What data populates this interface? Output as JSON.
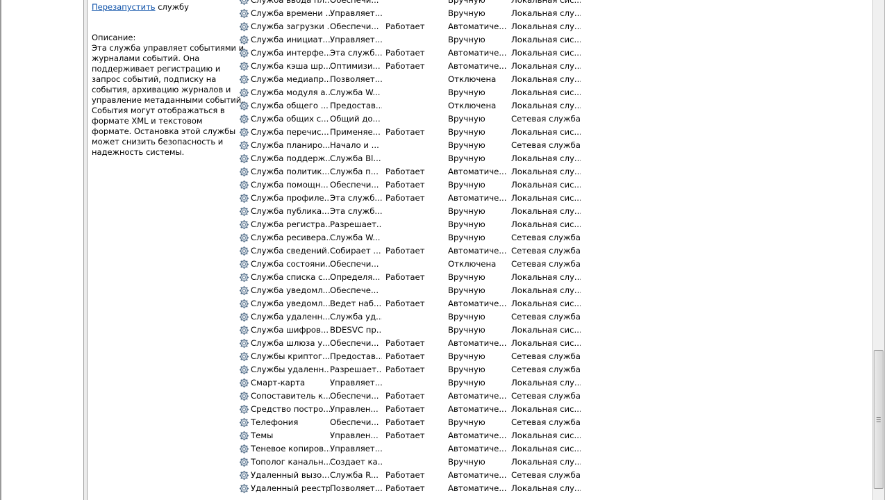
{
  "description_pane": {
    "restart_link": "Перезапустить",
    "restart_suffix": " службу",
    "description_label": "Описание:",
    "description_lines": [
      "Эта служба управляет событиями и",
      "журналами событий. Она",
      "поддерживает регистрацию и",
      "запрос событий, подписку на",
      "события, архивацию журналов и",
      "управление метаданными событий.",
      "События могут отображаться в",
      "формате XML и текстовом",
      "формате. Остановка этой службы",
      "может снизить безопасность и",
      "надежность системы."
    ]
  },
  "services": [
    {
      "name": "Служба ввода пл...",
      "description": "Обеспечи...",
      "status": "",
      "startup": "Вручную",
      "logon": "Локальная сис..."
    },
    {
      "name": "Служба времени ...",
      "description": "Управляет...",
      "status": "",
      "startup": "Вручную",
      "logon": "Локальная слу..."
    },
    {
      "name": "Служба загрузки ...",
      "description": "Обеспечи...",
      "status": "Работает",
      "startup": "Автоматиче...",
      "logon": "Локальная слу..."
    },
    {
      "name": "Служба инициат...",
      "description": "Управляет...",
      "status": "",
      "startup": "Вручную",
      "logon": "Локальная сис..."
    },
    {
      "name": "Служба интерфе...",
      "description": "Эта служб...",
      "status": "Работает",
      "startup": "Автоматиче...",
      "logon": "Локальная сис..."
    },
    {
      "name": "Служба кэша шр...",
      "description": "Оптимизи...",
      "status": "Работает",
      "startup": "Автоматиче...",
      "logon": "Локальная слу..."
    },
    {
      "name": "Служба медиапр...",
      "description": "Позволяет...",
      "status": "",
      "startup": "Отключена",
      "logon": "Локальная слу..."
    },
    {
      "name": "Служба модуля а...",
      "description": "Служба W...",
      "status": "",
      "startup": "Вручную",
      "logon": "Локальная сис..."
    },
    {
      "name": "Служба общего ...",
      "description": "Предостав...",
      "status": "",
      "startup": "Отключена",
      "logon": "Локальная слу..."
    },
    {
      "name": "Служба общих с...",
      "description": "Общий до...",
      "status": "",
      "startup": "Вручную",
      "logon": "Сетевая служба"
    },
    {
      "name": "Служба перечис...",
      "description": "Применяе...",
      "status": "Работает",
      "startup": "Вручную",
      "logon": "Локальная сис..."
    },
    {
      "name": "Служба планиро...",
      "description": "Начало и ...",
      "status": "",
      "startup": "Вручную",
      "logon": "Сетевая служба"
    },
    {
      "name": "Служба поддерж...",
      "description": "Служба Bl...",
      "status": "",
      "startup": "Вручную",
      "logon": "Локальная слу..."
    },
    {
      "name": "Служба политик...",
      "description": "Служба п...",
      "status": "Работает",
      "startup": "Автоматиче...",
      "logon": "Локальная слу..."
    },
    {
      "name": "Служба помощн...",
      "description": "Обеспечи...",
      "status": "Работает",
      "startup": "Вручную",
      "logon": "Локальная сис..."
    },
    {
      "name": "Служба профиле...",
      "description": "Эта служб...",
      "status": "Работает",
      "startup": "Автоматиче...",
      "logon": "Локальная сис..."
    },
    {
      "name": "Служба публика...",
      "description": "Эта служб...",
      "status": "",
      "startup": "Вручную",
      "logon": "Локальная слу..."
    },
    {
      "name": "Служба регистра...",
      "description": "Разрешает...",
      "status": "",
      "startup": "Вручную",
      "logon": "Локальная сис..."
    },
    {
      "name": "Служба ресивера...",
      "description": "Служба W...",
      "status": "",
      "startup": "Вручную",
      "logon": "Сетевая служба"
    },
    {
      "name": "Служба сведений...",
      "description": "Собирает ...",
      "status": "Работает",
      "startup": "Автоматиче...",
      "logon": "Сетевая служба"
    },
    {
      "name": "Служба состояни...",
      "description": "Обеспечи...",
      "status": "",
      "startup": "Отключена",
      "logon": "Сетевая служба"
    },
    {
      "name": "Служба списка с...",
      "description": "Определя...",
      "status": "Работает",
      "startup": "Вручную",
      "logon": "Локальная слу..."
    },
    {
      "name": "Служба уведомл...",
      "description": "Обеспече...",
      "status": "",
      "startup": "Вручную",
      "logon": "Локальная слу..."
    },
    {
      "name": "Служба уведомл...",
      "description": "Ведет наб...",
      "status": "Работает",
      "startup": "Автоматиче...",
      "logon": "Локальная сис..."
    },
    {
      "name": "Служба удаленн...",
      "description": "Служба уд...",
      "status": "",
      "startup": "Вручную",
      "logon": "Сетевая служба"
    },
    {
      "name": "Служба шифров...",
      "description": "BDESVC пр...",
      "status": "",
      "startup": "Вручную",
      "logon": "Локальная сис..."
    },
    {
      "name": "Служба шлюза у...",
      "description": "Обеспечи...",
      "status": "Работает",
      "startup": "Автоматиче...",
      "logon": "Локальная сис..."
    },
    {
      "name": "Службы криптог...",
      "description": "Предостав...",
      "status": "Работает",
      "startup": "Вручную",
      "logon": "Сетевая служба"
    },
    {
      "name": "Службы удаленн...",
      "description": "Разрешает...",
      "status": "Работает",
      "startup": "Вручную",
      "logon": "Сетевая служба"
    },
    {
      "name": "Смарт-карта",
      "description": "Управляет...",
      "status": "",
      "startup": "Вручную",
      "logon": "Локальная слу..."
    },
    {
      "name": "Сопоставитель к...",
      "description": "Обеспечи...",
      "status": "Работает",
      "startup": "Автоматиче...",
      "logon": "Сетевая служба"
    },
    {
      "name": "Средство постро...",
      "description": "Управлен...",
      "status": "Работает",
      "startup": "Автоматиче...",
      "logon": "Локальная сис..."
    },
    {
      "name": "Телефония",
      "description": "Обеспечи...",
      "status": "Работает",
      "startup": "Вручную",
      "logon": "Сетевая служба"
    },
    {
      "name": "Темы",
      "description": "Управлен...",
      "status": "Работает",
      "startup": "Автоматиче...",
      "logon": "Локальная сис..."
    },
    {
      "name": "Теневое копиров...",
      "description": "Управляет...",
      "status": "",
      "startup": "Автоматиче...",
      "logon": "Локальная сис..."
    },
    {
      "name": "Тополог канальн...",
      "description": "Создает ка...",
      "status": "",
      "startup": "Вручную",
      "logon": "Локальная слу..."
    },
    {
      "name": "Удаленный вызо...",
      "description": "Служба R...",
      "status": "Работает",
      "startup": "Автоматиче...",
      "logon": "Сетевая служба"
    },
    {
      "name": "Удаленный реестр",
      "description": "Позволяет...",
      "status": "Работает",
      "startup": "Автоматиче...",
      "logon": "Локальная слу..."
    }
  ],
  "icons": {
    "service": "gear-icon"
  },
  "colors": {
    "link": "#0a4fa8",
    "scroll_thumb": "#d6d6d6"
  }
}
